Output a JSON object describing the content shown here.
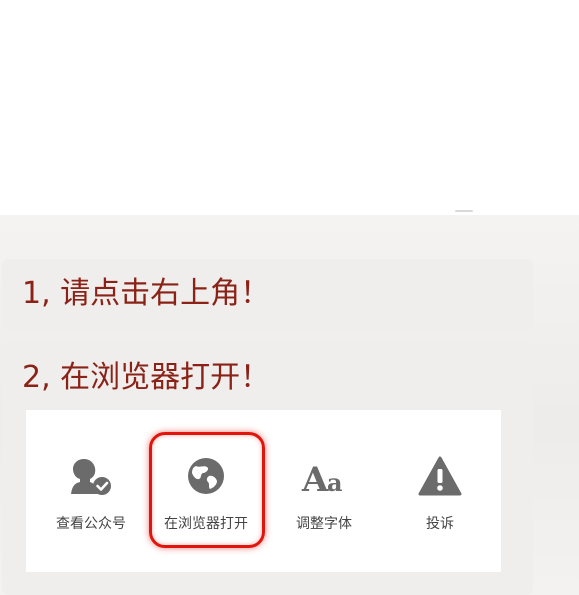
{
  "instructions": {
    "step1": "1, 请点击右上角！",
    "step2": "2, 在浏览器打开！"
  },
  "menu": {
    "items": [
      {
        "label": "查看公众号",
        "icon": "user-check-icon"
      },
      {
        "label": "在浏览器打开",
        "icon": "globe-icon",
        "highlighted": true
      },
      {
        "label": "调整字体",
        "icon": "font-size-icon"
      },
      {
        "label": "投诉",
        "icon": "warning-icon"
      }
    ]
  },
  "colors": {
    "instruction_text": "#8a2217",
    "icon_gray": "#6b6b6b",
    "highlight": "#e1150c"
  }
}
